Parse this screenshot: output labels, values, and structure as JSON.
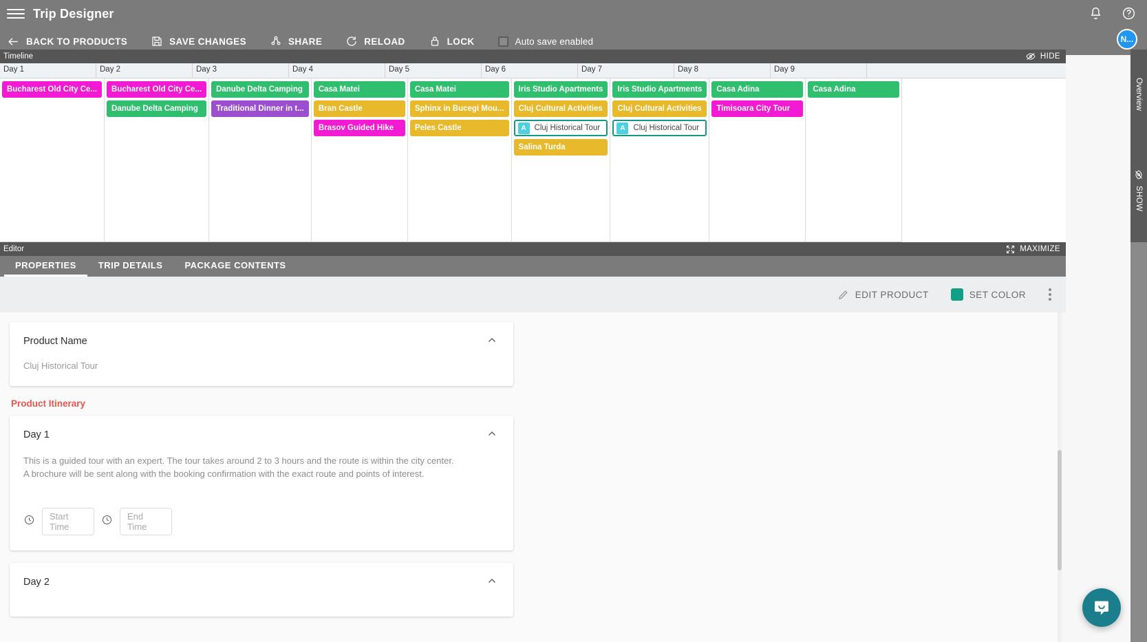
{
  "appbar": {
    "title": "Trip Designer",
    "menu_icon": "hamburger-icon",
    "notifications_icon": "bell-icon",
    "help_icon": "question-circle-icon",
    "avatar_initial": "N...",
    "avatar_color": "#2196f3"
  },
  "toolbar": {
    "back": "BACK TO PRODUCTS",
    "save": "SAVE CHANGES",
    "share": "SHARE",
    "reload": "RELOAD",
    "lock": "LOCK",
    "autosave": "Auto save enabled",
    "autosave_checked": false
  },
  "timeline": {
    "panel_title": "Timeline",
    "hide_label": "HIDE",
    "days": [
      "Day 1",
      "Day 2",
      "Day 3",
      "Day 4",
      "Day 5",
      "Day 6",
      "Day 7",
      "Day 8",
      "Day 9"
    ],
    "colors": {
      "green": "#2fbf6e",
      "yellow": "#e8b92a",
      "magenta": "#f31ad4",
      "purple": "#9b4fcf",
      "selected_border": "#119a86",
      "badge": "#4fd0e0"
    },
    "columns": [
      {
        "day": "Day 1",
        "events": [
          {
            "label": "Bucharest Old City Ce...",
            "color": "#f31ad4",
            "selected": false
          }
        ]
      },
      {
        "day": "Day 2",
        "events": [
          {
            "label": "Bucharest Old City Ce...",
            "color": "#f31ad4",
            "selected": false
          },
          {
            "label": "Danube Delta Camping",
            "color": "#2fbf6e",
            "selected": false
          }
        ]
      },
      {
        "day": "Day 3",
        "events": [
          {
            "label": "Danube Delta Camping",
            "color": "#2fbf6e",
            "selected": false
          },
          {
            "label": "Traditional Dinner in t...",
            "color": "#9b4fcf",
            "selected": false
          }
        ]
      },
      {
        "day": "Day 4",
        "events": [
          {
            "label": "Casa Matei",
            "color": "#2fbf6e",
            "selected": false
          },
          {
            "label": "Bran Castle",
            "color": "#e8b92a",
            "selected": false
          },
          {
            "label": "Brasov Guided Hike",
            "color": "#f31ad4",
            "selected": false
          }
        ]
      },
      {
        "day": "Day 5",
        "events": [
          {
            "label": "Casa Matei",
            "color": "#2fbf6e",
            "selected": false
          },
          {
            "label": "Sphinx in Bucegi Mou...",
            "color": "#e8b92a",
            "selected": false
          },
          {
            "label": "Peles Castle",
            "color": "#e8b92a",
            "selected": false
          }
        ]
      },
      {
        "day": "Day 6",
        "events": [
          {
            "label": "Iris Studio Apartments",
            "color": "#2fbf6e",
            "selected": false
          },
          {
            "label": "Cluj Cultural Activities",
            "color": "#e8b92a",
            "selected": false
          },
          {
            "label": "Cluj Historical Tour",
            "color": "#ffffff",
            "selected": true,
            "badge": "A"
          },
          {
            "label": "Salina Turda",
            "color": "#e8b92a",
            "selected": false
          }
        ]
      },
      {
        "day": "Day 7",
        "events": [
          {
            "label": "Iris Studio Apartments",
            "color": "#2fbf6e",
            "selected": false
          },
          {
            "label": "Cluj Cultural Activities",
            "color": "#e8b92a",
            "selected": false
          },
          {
            "label": "Cluj Historical Tour",
            "color": "#ffffff",
            "selected": true,
            "badge": "A"
          }
        ]
      },
      {
        "day": "Day 8",
        "events": [
          {
            "label": "Casa Adina",
            "color": "#2fbf6e",
            "selected": false
          },
          {
            "label": "Timisoara City Tour",
            "color": "#f31ad4",
            "selected": false
          }
        ]
      },
      {
        "day": "Day 9",
        "events": [
          {
            "label": "Casa Adina",
            "color": "#2fbf6e",
            "selected": false
          }
        ]
      }
    ]
  },
  "rail": {
    "overview_label": "Overview",
    "show_label": "SHOW"
  },
  "editor": {
    "panel_title": "Editor",
    "maximize_label": "MAXIMIZE",
    "tabs": [
      {
        "label": "PROPERTIES",
        "active": true
      },
      {
        "label": "TRIP DETAILS",
        "active": false
      },
      {
        "label": "PACKAGE CONTENTS",
        "active": false
      }
    ],
    "actions": {
      "edit_product": "EDIT PRODUCT",
      "set_color": "SET COLOR",
      "set_color_swatch": "#11a085",
      "more_label": "more-options"
    },
    "product_name_card": {
      "title": "Product Name",
      "value": "Cluj Historical Tour",
      "collapsed": false
    },
    "itinerary_label": "Product Itinerary",
    "itinerary": [
      {
        "title": "Day 1",
        "paragraph_1": "This is a guided tour with an expert. The tour takes around 2 to 3 hours and the route is within the city center.",
        "paragraph_2": "A brochure will be sent along with the booking confirmation with the exact route and points of interest.",
        "start_time_placeholder": "Start Time",
        "start_time_value": "",
        "end_time_placeholder": "End Time",
        "end_time_value": ""
      },
      {
        "title": "Day 2"
      }
    ]
  },
  "chat": {
    "label": "chat-launcher",
    "color": "#1b7e8c"
  }
}
